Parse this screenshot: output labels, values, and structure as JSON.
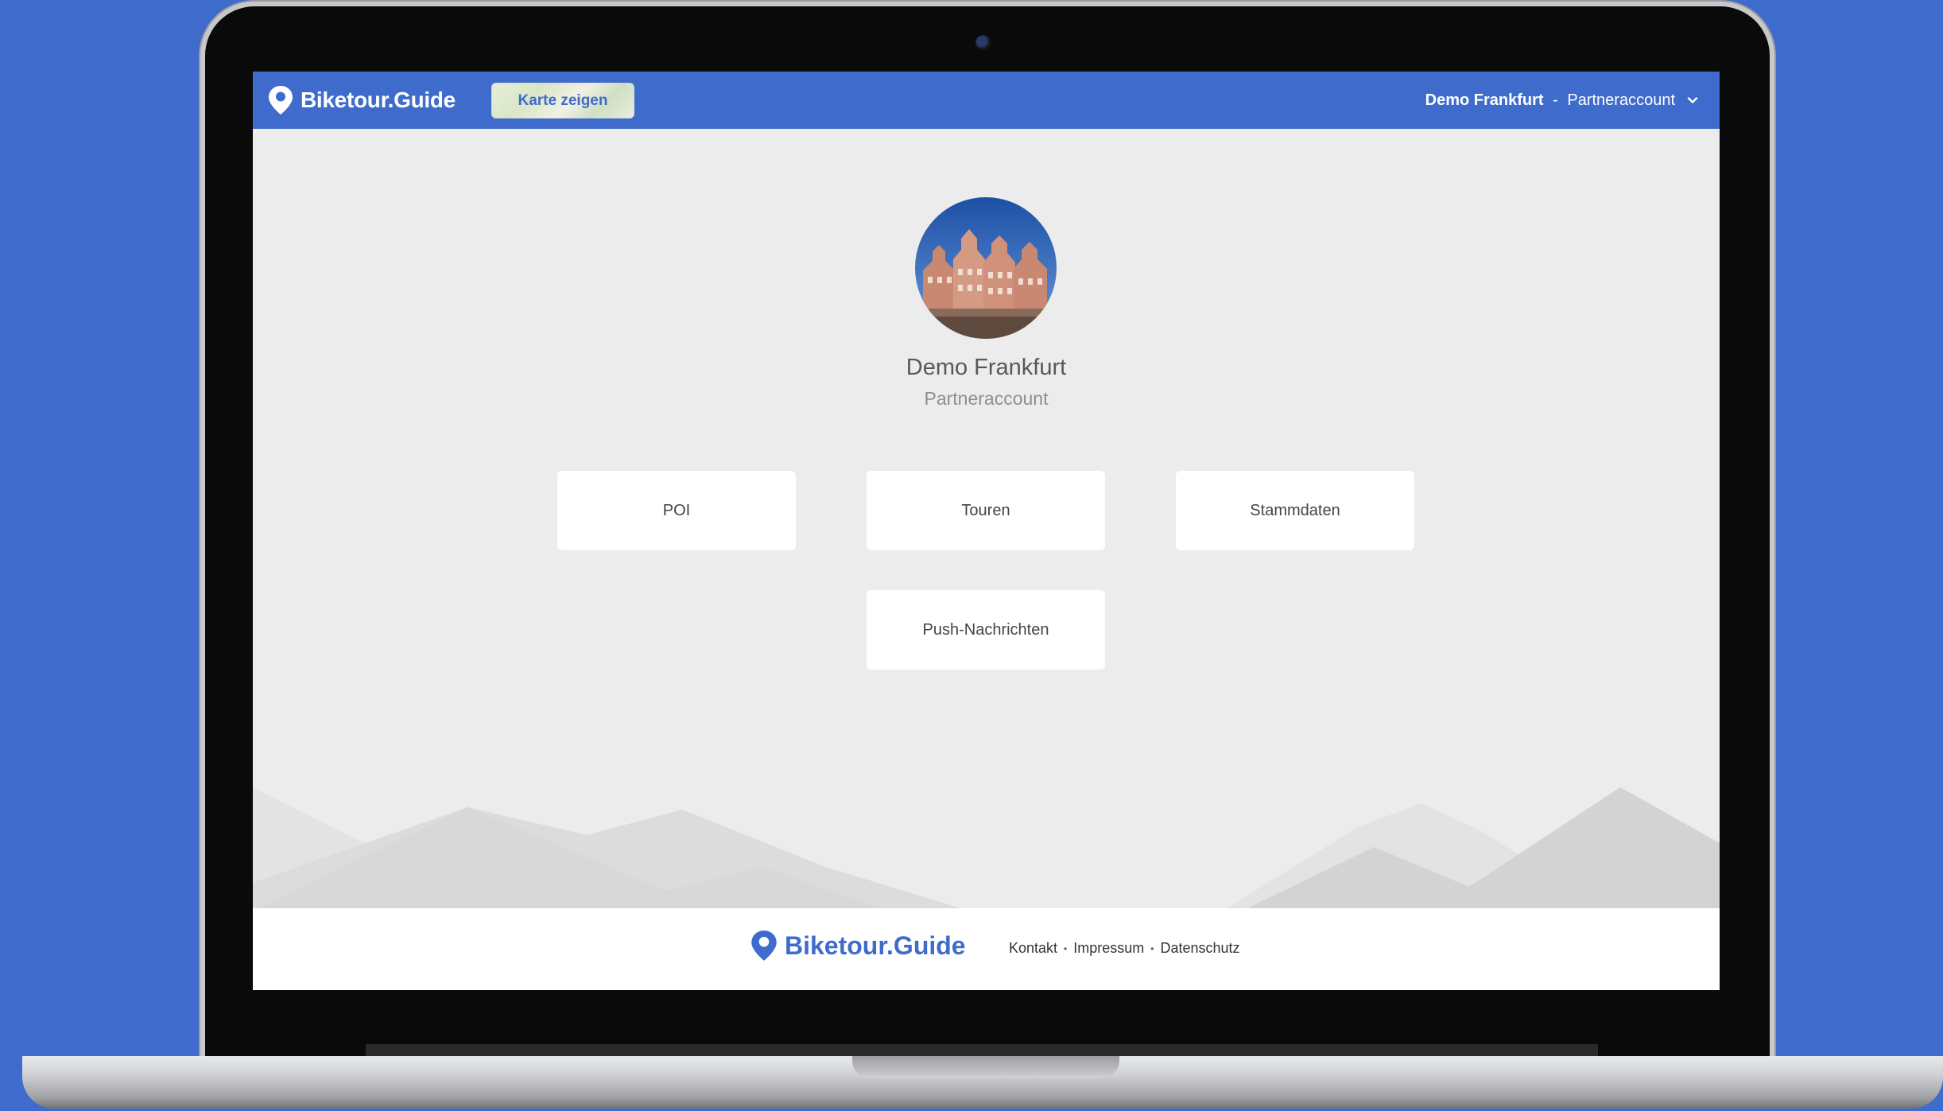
{
  "app": {
    "brand": "Biketour.Guide",
    "accent_color": "#3f6ccc"
  },
  "header": {
    "map_button_label": "Karte zeigen",
    "account_name": "Demo Frankfurt",
    "account_separator": " - ",
    "account_role": "Partneraccount"
  },
  "profile": {
    "name": "Demo Frankfurt",
    "role": "Partneraccount"
  },
  "tiles": [
    {
      "label": "POI"
    },
    {
      "label": "Touren"
    },
    {
      "label": "Stammdaten"
    },
    {
      "label": "Push-Nachrichten"
    }
  ],
  "footer": {
    "brand": "Biketour.Guide",
    "links": [
      {
        "label": "Kontakt"
      },
      {
        "label": "Impressum"
      },
      {
        "label": "Datenschutz"
      }
    ],
    "separator": "•"
  }
}
